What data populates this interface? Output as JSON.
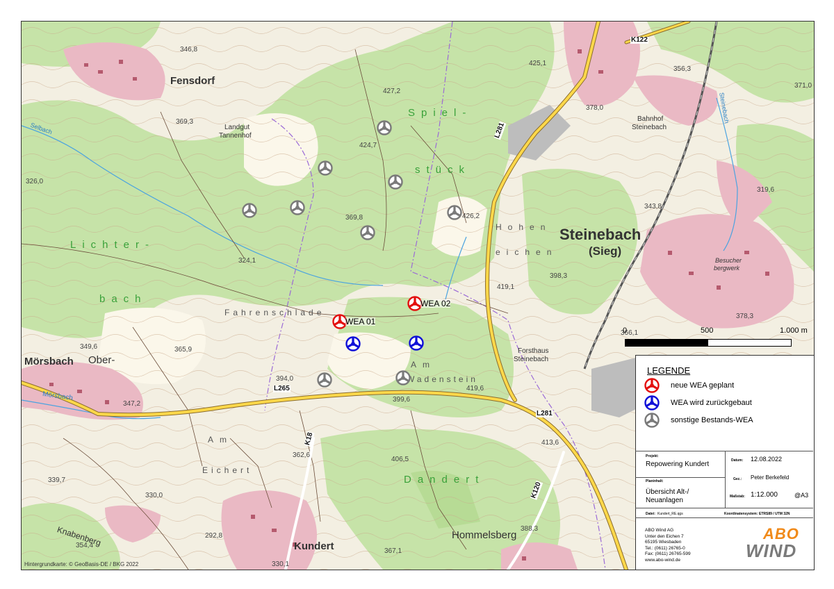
{
  "map": {
    "places": {
      "fensdorf": "Fensdorf",
      "steinebach": "Steinebach",
      "steinebach_sieg": "(Sieg)",
      "moersbach": "Mörsbach",
      "ober": "Ober-",
      "kundert": "Kundert",
      "hommelsberg": "Hommelsberg",
      "landgut": "Landgut",
      "tannenhof": "Tannenhof",
      "bahnhof": "Bahnhof",
      "bahnhof2": "Steinebach",
      "forsthaus": "Forsthaus",
      "forsthaus2": "Steinebach",
      "besucher": "Besucher",
      "bergwerk": "bergwerk",
      "steinebach_creek": "Steinebach",
      "moersbach_creek": "Mörsbach",
      "selbach": "Selbach",
      "knabenberg": "Knabenberg"
    },
    "fields": {
      "spiel": "Spiel-",
      "stueck": "stück",
      "lichter": "Lichter-",
      "bach": "bach",
      "hohen": "Hohen",
      "eichen": "eichen",
      "fahrenschlade": "Fahrenschlade",
      "am1": "Am",
      "wadenstein": "Wadenstein",
      "am2": "Am",
      "eichert": "Eichert",
      "dandert": "Dandert"
    },
    "roads": {
      "k122": "K122",
      "l281a": "L281",
      "l281b": "L281",
      "l265": "L265",
      "k18": "K18",
      "k120": "K120"
    },
    "spot_heights": [
      "346,8",
      "427,2",
      "425,1",
      "356,3",
      "371,0",
      "378,0",
      "369,3",
      "424,7",
      "326,0",
      "369,8",
      "426,2",
      "343,8",
      "319,6",
      "324,1",
      "419,1",
      "398,3",
      "378,3",
      "365,9",
      "349,6",
      "394,0",
      "419,6",
      "399,6",
      "347,2",
      "413,6",
      "362,6",
      "406,5",
      "339,7",
      "330,0",
      "292,8",
      "354,4",
      "388,3",
      "330,1",
      "367,1",
      "366,1"
    ],
    "credit": "Hintergrundkarte: © GeoBasis-DE / BKG 2022",
    "turbines": {
      "new": [
        {
          "label": "WEA 01"
        },
        {
          "label": "WEA 02"
        }
      ]
    },
    "scale_bar": {
      "labels": [
        "0",
        "500",
        "1.000 m"
      ]
    }
  },
  "legend": {
    "title": "LEGENDE",
    "items": [
      {
        "text": "neue WEA geplant",
        "color": "#e3100f"
      },
      {
        "text": "WEA wird zurückgebaut",
        "color": "#1010d8"
      },
      {
        "text": "sonstige Bestands-WEA",
        "color": "#7a7a7a"
      }
    ]
  },
  "title_block": {
    "projekt_label": "Projekt:",
    "projekt": "Repowering Kundert",
    "datum_label": "Datum:",
    "datum": "12.08.2022",
    "gez_label": "Gez.:",
    "gez": "Peter Berkefeld",
    "planinhalt_label": "Planinhalt:",
    "planinhalt_1": "Übersicht Alt-/",
    "planinhalt_2": "Neuanlagen",
    "massstab_label": "Maßstab:",
    "massstab": "1:12.000",
    "format": "@A3",
    "datei_label": "Datei:",
    "datei": "Kundert_RE.qgs",
    "koord_label": "Koordinatensystem:",
    "koord": "ETRS89 / UTM 32N",
    "company": [
      "ABO Wind AG",
      "Unter den Eichen 7",
      "65195 Wiesbaden",
      "Tel.: (0611) 26765-0",
      "Fax: (0611) 26765-599",
      "www.abo-wind.de"
    ],
    "logo_top": "ABO",
    "logo_bottom": "WIND"
  }
}
